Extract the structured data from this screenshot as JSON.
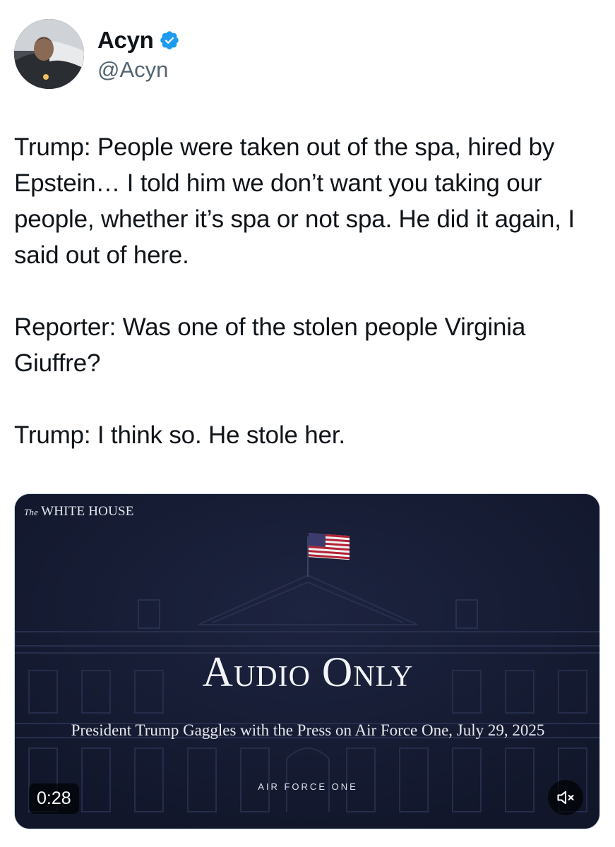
{
  "author": {
    "display_name": "Acyn",
    "handle": "@Acyn",
    "verified": true,
    "verified_color": "#1d9bf0"
  },
  "tweet": {
    "paragraphs": [
      "Trump: People were taken out of the spa, hired by Epstein… I told him we don’t want you taking our people, whether it’s spa or not spa. He did it again, I said out of here.",
      "Reporter: Was one of the stolen people Virginia Giuffre?",
      "Trump: I think so. He stole her."
    ]
  },
  "media": {
    "logo_prefix": "The",
    "logo_name": "WHITE HOUSE",
    "title": "Audio Only",
    "subtitle": "President Trump Gaggles with the Press on Air Force One, July 29, 2025",
    "location": "AIR FORCE ONE",
    "duration": "0:28",
    "mute_icon": "speaker-muted-icon",
    "background_color": "#151a2e"
  }
}
